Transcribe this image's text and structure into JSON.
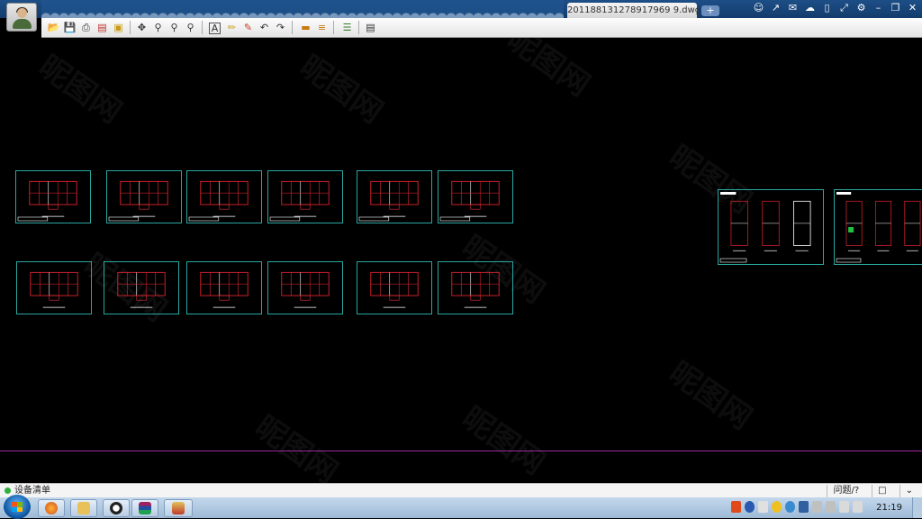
{
  "titlebar": {
    "document_tab": "201188131278917969 9.dwg*",
    "new_tab": "+"
  },
  "window_controls": [
    "user-icon",
    "share-icon",
    "chat-icon",
    "cloud-icon",
    "phone-icon",
    "fullscreen-icon",
    "settings-icon",
    "minimize-icon",
    "restore-icon",
    "close-icon"
  ],
  "toolbar": {
    "icons": [
      "open-icon",
      "save-icon",
      "print-icon",
      "export-pdf-icon",
      "lock-icon",
      "pan-icon",
      "zoom-window-icon",
      "zoom-icon",
      "zoom-extent-icon",
      "text-icon",
      "pen-icon",
      "markup-icon",
      "undo-icon",
      "redo-icon",
      "measure-icon",
      "dimension-icon",
      "layers-icon",
      "properties-icon"
    ]
  },
  "canvas": {
    "watermark": "昵图网",
    "drawing_sheets": 14
  },
  "statusbar": {
    "text": "设备清单",
    "help_label": "问题/?",
    "buttons": [
      "comment-icon",
      "expand-icon"
    ]
  },
  "taskbar": {
    "clock": "21:19",
    "apps": [
      "firefox-icon",
      "folder-icon",
      "qq-icon",
      "winrar-icon",
      "cad-viewer-icon"
    ],
    "colors": {
      "taskbar": "#a8c3de",
      "sheet_border": "#2aa7a0",
      "drawing": "#c8202a"
    }
  }
}
